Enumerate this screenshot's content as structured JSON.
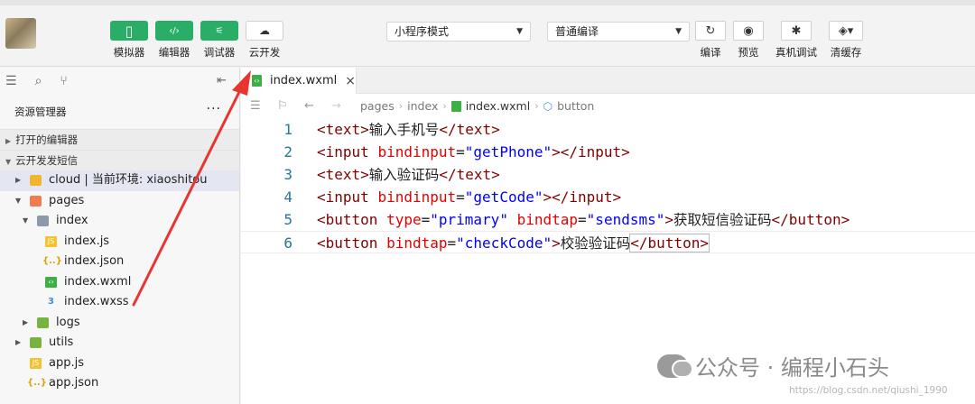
{
  "toolbar": {
    "buttons": [
      {
        "label": "模拟器",
        "icon": "phone-icon"
      },
      {
        "label": "编辑器",
        "icon": "code-icon"
      },
      {
        "label": "调试器",
        "icon": "debug-icon"
      },
      {
        "label": "云开发",
        "icon": "cloud-icon"
      }
    ],
    "mode_select": "小程序模式",
    "compile_select": "普通编译",
    "actions": [
      {
        "label": "编译",
        "icon": "refresh-icon"
      },
      {
        "label": "预览",
        "icon": "eye-icon"
      },
      {
        "label": "真机调试",
        "icon": "bug-icon"
      },
      {
        "label": "清缓存",
        "icon": "layers-icon"
      }
    ]
  },
  "sidebar": {
    "explorer_title": "资源管理器",
    "more": "···",
    "section_open_editors": "打开的编辑器",
    "section_project": "云开发发短信",
    "tree": [
      {
        "label": "cloud | 当前环境: xiaoshitou",
        "type": "folder",
        "selected": true
      },
      {
        "label": "pages",
        "type": "folder"
      },
      {
        "label": "index",
        "type": "folder"
      },
      {
        "label": "index.js",
        "type": "js",
        "badge": "JS"
      },
      {
        "label": "index.json",
        "type": "json",
        "badge": "{..}"
      },
      {
        "label": "index.wxml",
        "type": "wxml"
      },
      {
        "label": "index.wxss",
        "type": "wxss"
      },
      {
        "label": "logs",
        "type": "folder"
      },
      {
        "label": "utils",
        "type": "folder"
      },
      {
        "label": "app.js",
        "type": "js",
        "badge": "JS"
      },
      {
        "label": "app.json",
        "type": "json",
        "badge": "{..}"
      }
    ]
  },
  "editor": {
    "tab": {
      "label": "index.wxml",
      "close": "×"
    },
    "breadcrumb": {
      "pages": "pages",
      "index": "index",
      "file": "index.wxml",
      "node": "button"
    },
    "line_numbers": [
      "1",
      "2",
      "3",
      "4",
      "5",
      "6"
    ],
    "code": {
      "l1": {
        "t1": "<text>",
        "c": "输入手机号",
        "t2": "</text>"
      },
      "l2": {
        "t1": "<input",
        "a": "bindinput",
        "eq": "=",
        "v": "\"getPhone\"",
        "t2": "></input>"
      },
      "l3": {
        "t1": "<text>",
        "c": "输入验证码",
        "t2": "</text>"
      },
      "l4": {
        "t1": "<input",
        "a": "bindinput",
        "eq": "=",
        "v": "\"getCode\"",
        "t2": "></input>"
      },
      "l5": {
        "t1": "<button",
        "a1": "type",
        "eq": "=",
        "v1": "\"primary\"",
        "a2": "bindtap",
        "v2": "\"sendsms\"",
        "t2": ">",
        "c": "获取短信验证码",
        "t3": "</button>"
      },
      "l6": {
        "t1": "<button",
        "a": "bindtap",
        "eq": "=",
        "v": "\"checkCode\"",
        "t2": ">",
        "c": "校验验证码",
        "t3": "</button>"
      }
    }
  },
  "watermark": {
    "text": "公众号 · 编程小石头",
    "csdn": "https://blog.csdn.net/qiushi_1990"
  },
  "colors": {
    "accent_green": "#2aae67",
    "annotation_red": "#e8352f"
  }
}
